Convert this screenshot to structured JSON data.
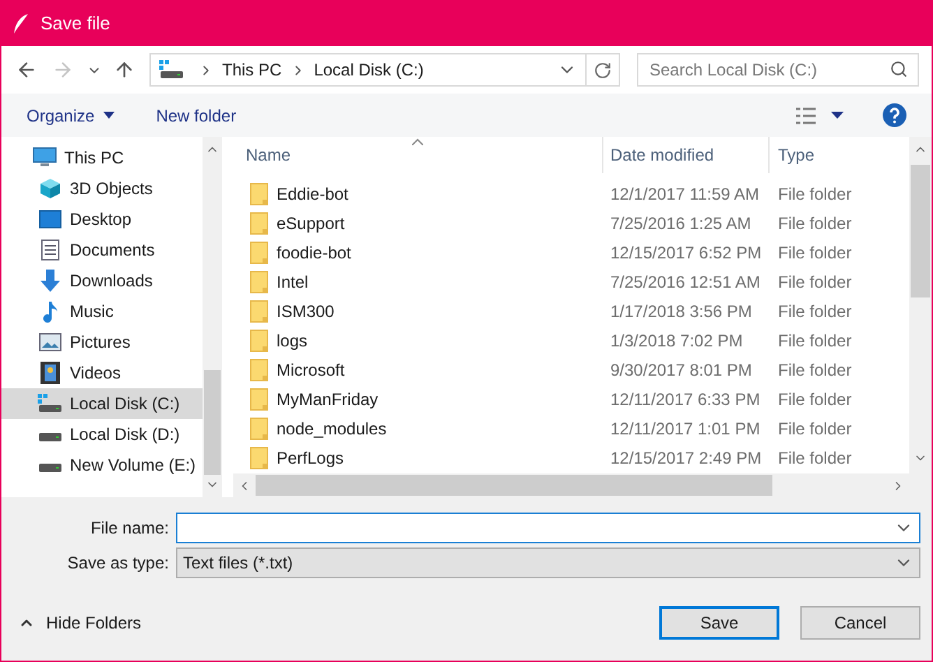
{
  "window": {
    "title": "Save file"
  },
  "navigation": {
    "buttons": [
      {
        "kind": "back",
        "disabled": false
      },
      {
        "kind": "forward",
        "disabled": true
      },
      {
        "kind": "recent",
        "disabled": false
      },
      {
        "kind": "up",
        "disabled": false
      }
    ],
    "breadcrumb": [
      "This PC",
      "Local Disk (C:)"
    ],
    "search": {
      "placeholder": "Search Local Disk (C:)"
    }
  },
  "toolbar": {
    "organize": "Organize",
    "new_folder": "New folder"
  },
  "sidebar": {
    "items": [
      {
        "label": "This PC",
        "kind": "pc",
        "selected": false,
        "children": [
          {
            "label": "3D Objects",
            "kind": "cube",
            "selected": false
          },
          {
            "label": "Desktop",
            "kind": "desktop",
            "selected": false
          },
          {
            "label": "Documents",
            "kind": "documents",
            "selected": false
          },
          {
            "label": "Downloads",
            "kind": "downloads",
            "selected": false
          },
          {
            "label": "Music",
            "kind": "music",
            "selected": false
          },
          {
            "label": "Pictures",
            "kind": "pictures",
            "selected": false
          },
          {
            "label": "Videos",
            "kind": "videos",
            "selected": false
          },
          {
            "label": "Local Disk (C:)",
            "kind": "system_drive",
            "selected": true
          },
          {
            "label": "Local Disk (D:)",
            "kind": "drive",
            "selected": false
          },
          {
            "label": "New Volume (E:)",
            "kind": "drive",
            "selected": false
          }
        ]
      }
    ]
  },
  "table": {
    "columns": [
      "Name",
      "Date modified",
      "Type"
    ],
    "rows": [
      {
        "name": "Eddie-bot",
        "date": "12/1/2017 11:59 AM",
        "type": "File folder"
      },
      {
        "name": "eSupport",
        "date": "7/25/2016 1:25 AM",
        "type": "File folder"
      },
      {
        "name": "foodie-bot",
        "date": "12/15/2017 6:52 PM",
        "type": "File folder"
      },
      {
        "name": "Intel",
        "date": "7/25/2016 12:51 AM",
        "type": "File folder"
      },
      {
        "name": "ISM300",
        "date": "1/17/2018 3:56 PM",
        "type": "File folder"
      },
      {
        "name": "logs",
        "date": "1/3/2018 7:02 PM",
        "type": "File folder"
      },
      {
        "name": "Microsoft",
        "date": "9/30/2017 8:01 PM",
        "type": "File folder"
      },
      {
        "name": "MyManFriday",
        "date": "12/11/2017 6:33 PM",
        "type": "File folder"
      },
      {
        "name": "node_modules",
        "date": "12/11/2017 1:01 PM",
        "type": "File folder"
      },
      {
        "name": "PerfLogs",
        "date": "12/15/2017 2:49 PM",
        "type": "File folder"
      }
    ]
  },
  "form": {
    "file_name": {
      "label": "File name:"
    },
    "save_as_type": {
      "label": "Save as type:",
      "value": "Text files (*.txt)"
    }
  },
  "hide_folders": "Hide Folders",
  "buttons": [
    {
      "label": "Save",
      "default": true
    },
    {
      "label": "Cancel",
      "default": false
    }
  ]
}
